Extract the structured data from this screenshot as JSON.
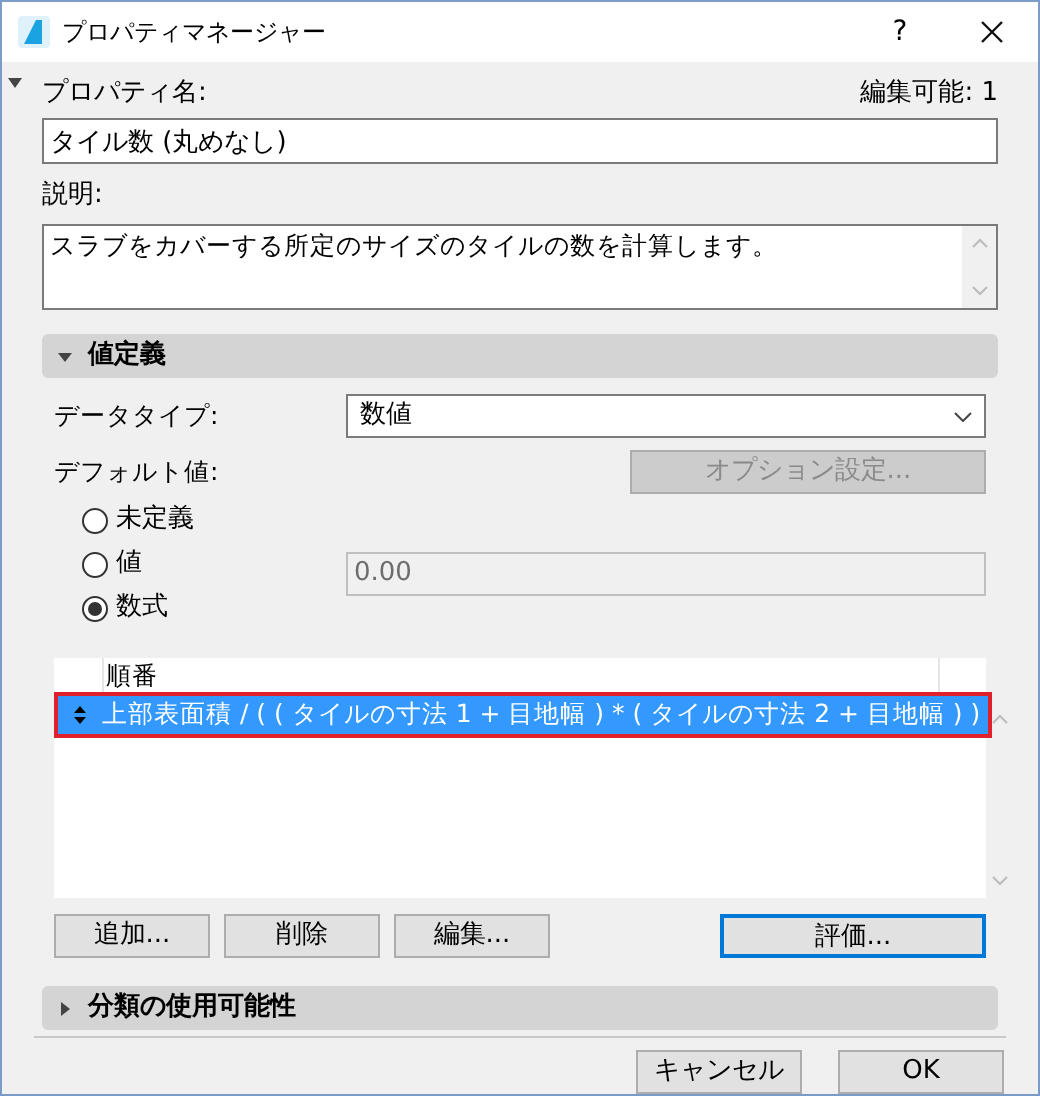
{
  "window": {
    "title": "プロパティマネージャー",
    "help": "?"
  },
  "property_name": {
    "label": "プロパティ名:",
    "editable": "編集可能: 1",
    "value": "タイル数 (丸めなし)"
  },
  "description": {
    "label": "説明:",
    "value": "スラブをカバーする所定のサイズのタイルの数を計算します。"
  },
  "value_definition": {
    "title": "値定義",
    "expanded": true,
    "data_type": {
      "label": "データタイプ:",
      "value": "数値"
    },
    "default_value": {
      "label": "デフォルト値:",
      "options_button": {
        "label": "オプション設定...",
        "disabled": true
      }
    },
    "radios": [
      {
        "label": "未定義",
        "selected": false
      },
      {
        "label": "値",
        "selected": false
      },
      {
        "label": "数式",
        "selected": true
      }
    ],
    "value_field": {
      "value": "0.00",
      "disabled": true
    },
    "list": {
      "header": "順番",
      "rows": [
        {
          "text": "上部表面積 / ( ( タイルの寸法 1 + 目地幅 ) * ( タイルの寸法 2 + 目地幅 ) )",
          "selected": true,
          "highlighted": true
        }
      ]
    },
    "buttons": [
      {
        "label": "追加...",
        "focused": false
      },
      {
        "label": "削除",
        "focused": false
      },
      {
        "label": "編集...",
        "focused": false
      },
      {
        "label": "評価...",
        "focused": true
      }
    ]
  },
  "classification": {
    "title": "分類の使用可能性",
    "expanded": false
  },
  "footer_buttons": [
    "キャンセル",
    "OK"
  ]
}
